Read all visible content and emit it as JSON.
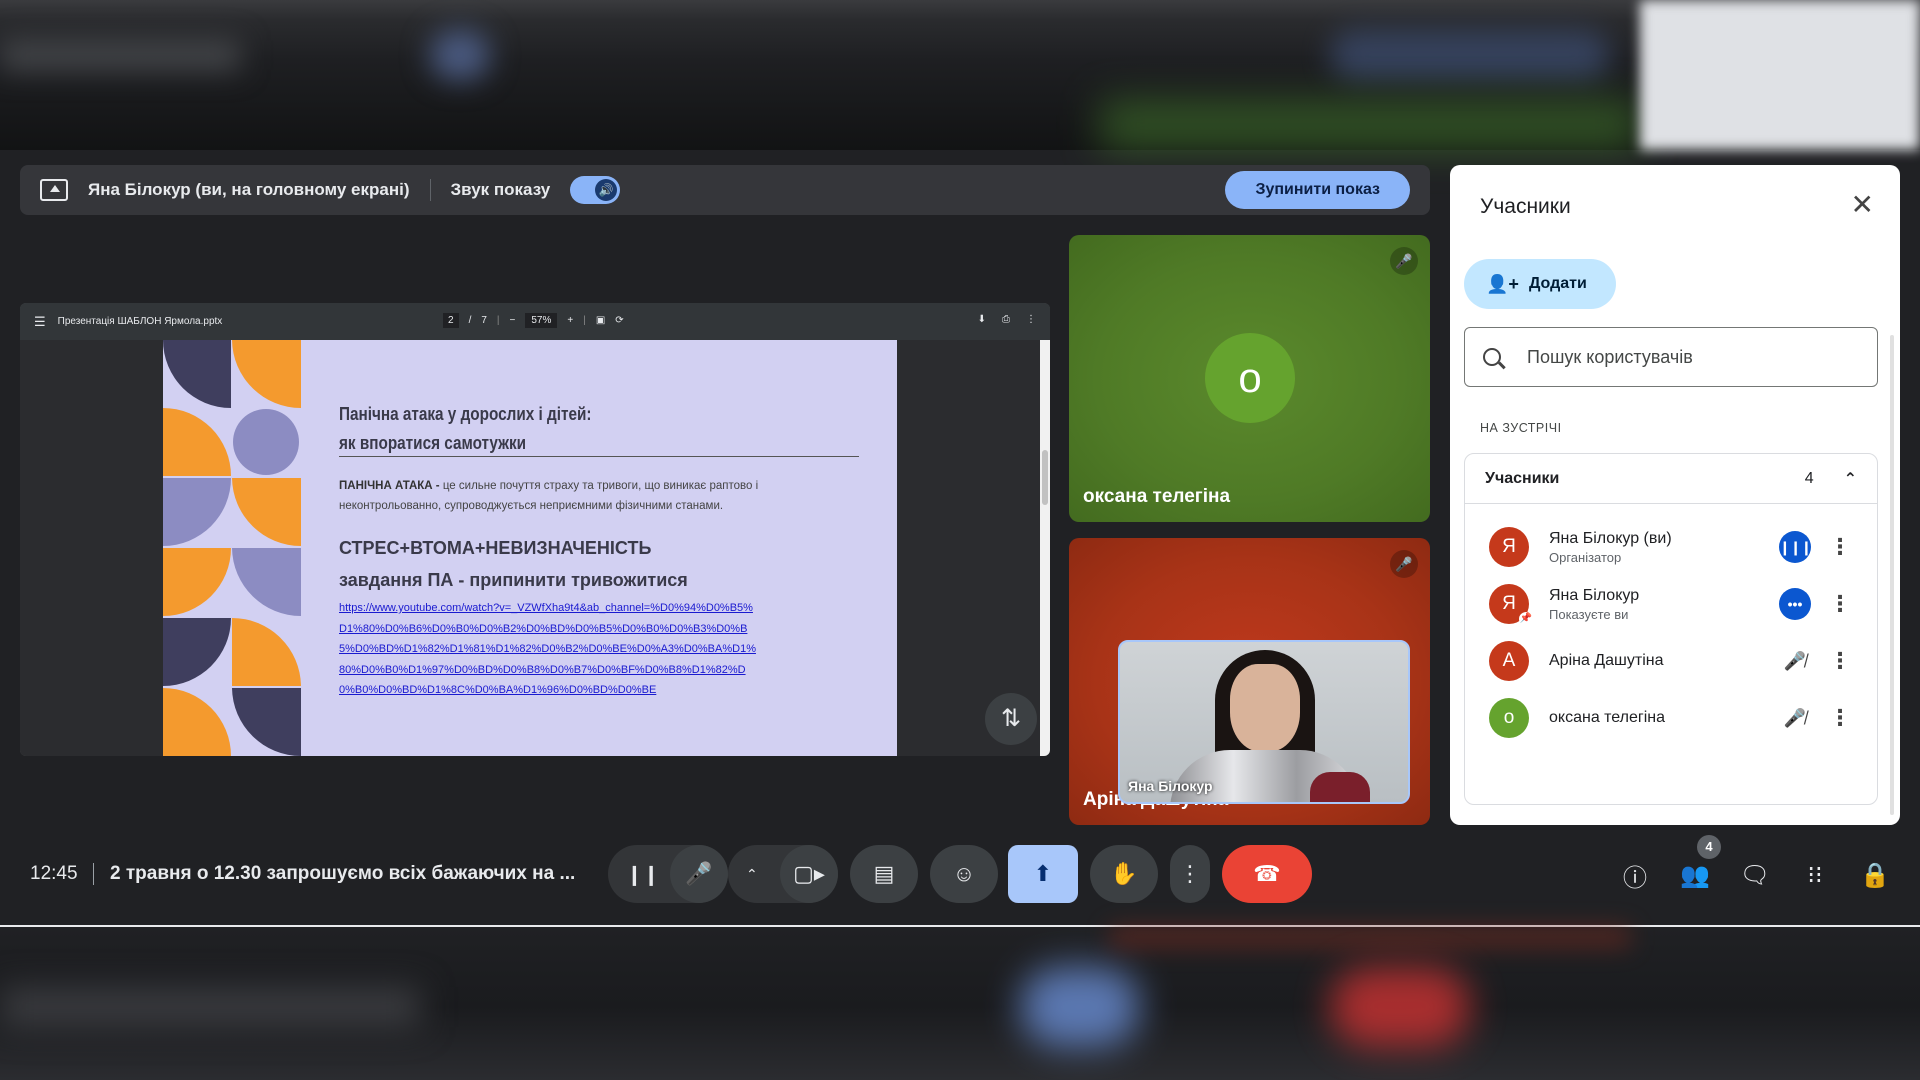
{
  "share_bar": {
    "presenter": "Яна Білокур (ви, на головному екрані)",
    "sound_label": "Звук показу",
    "stop_button": "Зупинити показ"
  },
  "pdf_viewer": {
    "filename": "Презентація ШАБЛОН Ярмола.pptx",
    "page_current": "2",
    "page_sep": "/",
    "page_total": "7",
    "zoom": "57%",
    "zoom_minus": "−",
    "zoom_plus": "+"
  },
  "slide": {
    "title_line1": "Панічна атака у дорослих і дітей:",
    "title_line2": "як впоратися самотужки",
    "definition_term": "ПАНІЧНА АТАКА - ",
    "definition_text": " це сильне почуття страху та тривоги, що виникає раптово і неконтрольованно, супроводжується неприємними фізичними станами.",
    "heading_stress": "СТРЕС+ВТОМА+НЕВИЗНАЧЕНІСТЬ",
    "heading_task": "завдання ПА - припинити тривожитися",
    "link": "https://www.youtube.com/watch?v=_VZWfXha9t4&ab_channel=%D0%94%D0%B5%D1%80%D0%B6%D0%B0%D0%B2%D0%BD%D0%B5%D0%B0%D0%B3%D0%B5%D0%BD%D1%82%D1%81%D1%82%D0%B2%D0%BE%D0%A3%D0%BA%D1%80%D0%B0%D1%97%D0%BD%D0%B8%D0%B7%D0%BF%D0%B8%D1%82%D0%B0%D0%BD%D1%8C%D0%BA%D1%96%D0%BD%D0%BE"
  },
  "tiles": {
    "oksana": {
      "initial": "о",
      "name": "оксана телегіна"
    },
    "arina": {
      "name": "Аріна Дашутіна"
    },
    "self_view": {
      "name": "Яна Білокур"
    }
  },
  "panel": {
    "title": "Учасники",
    "add_button": "Додати",
    "search_placeholder": "Пошук користувачів",
    "section_label": "НА ЗУСТРІЧІ",
    "group_label": "Учасники",
    "group_count": "4",
    "participants": [
      {
        "initial": "Я",
        "name": "Яна Білокур (ви)",
        "sub": "Організатор",
        "color": "#c5391b",
        "state": "speaking"
      },
      {
        "initial": "Я",
        "name": "Яна Білокур",
        "sub": "Показуєте ви",
        "color": "#c5391b",
        "state": "dots"
      },
      {
        "initial": "А",
        "name": "Аріна Дашутіна",
        "sub": "",
        "color": "#c5391b",
        "state": "muted"
      },
      {
        "initial": "о",
        "name": "оксана телегіна",
        "sub": "",
        "color": "#65a32e",
        "state": "muted"
      }
    ]
  },
  "bottom_bar": {
    "time": "12:45",
    "meeting_title": "2 травня о 12.30 запрошуємо всіх бажаючих на ...",
    "people_badge": "4"
  },
  "colors": {
    "accent": "#8ab4f8",
    "hangup": "#ea4335",
    "tile_green": "#4f7a26",
    "tile_red": "#a83317",
    "slide_bg": "#d2d0f2"
  }
}
